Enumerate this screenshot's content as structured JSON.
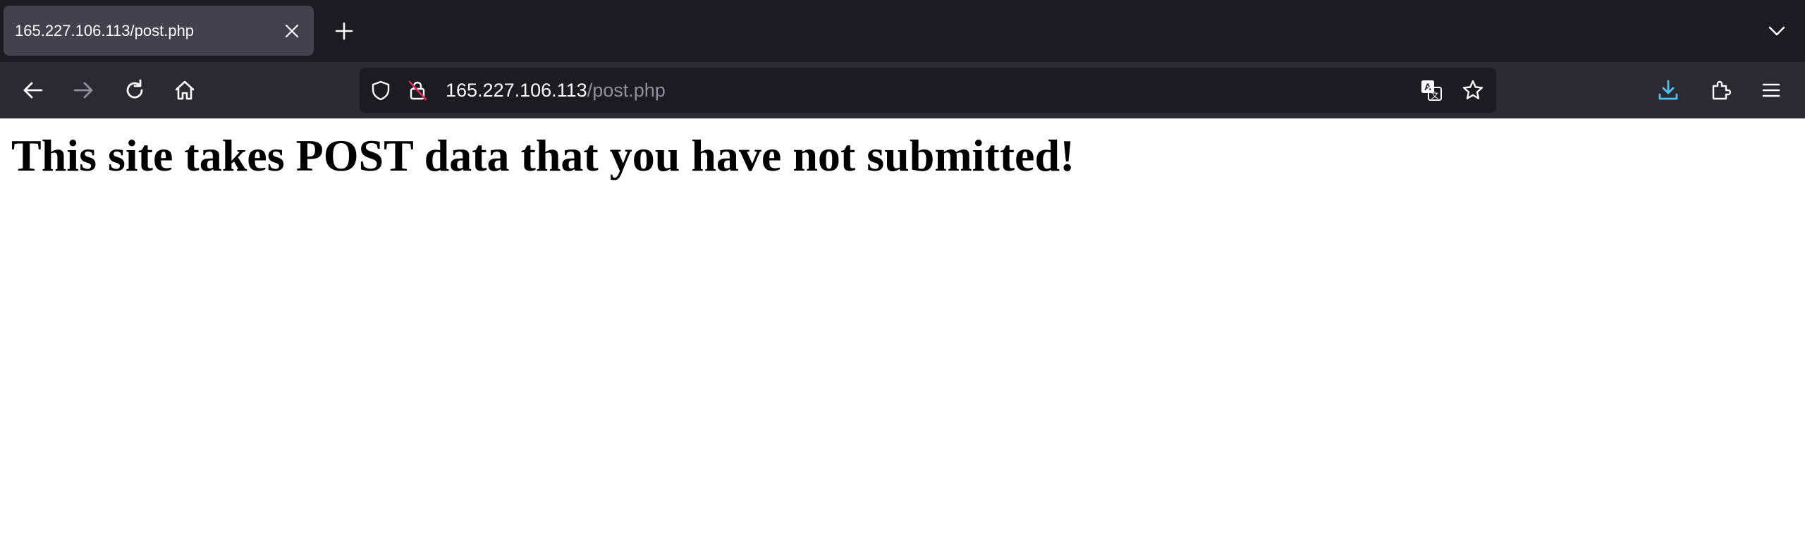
{
  "browser": {
    "tab": {
      "title": "165.227.106.113/post.php"
    },
    "url": {
      "host": "165.227.106.113",
      "path": "/post.php"
    },
    "icons": {
      "tab_close": "close-icon",
      "new_tab": "plus-icon",
      "tab_list": "chevron-down-icon",
      "back": "arrow-left-icon",
      "forward": "arrow-right-icon",
      "reload": "reload-icon",
      "home": "home-icon",
      "tracking_protection": "shield-icon",
      "insecure": "lock-crossed-icon",
      "translate": "translate-icon",
      "bookmark": "star-icon",
      "downloads": "download-icon",
      "extensions": "puzzle-icon",
      "menu": "hamburger-menu-icon"
    },
    "colors": {
      "tabbar_bg": "#1c1b22",
      "toolbar_bg": "#2b2a33",
      "active_tab_bg": "#42414d",
      "urlbar_bg": "#1c1b22",
      "download_accent": "#54c0f0",
      "insecure_slash": "#e22850"
    }
  },
  "page": {
    "heading": "This site takes POST data that you have not submitted!"
  }
}
